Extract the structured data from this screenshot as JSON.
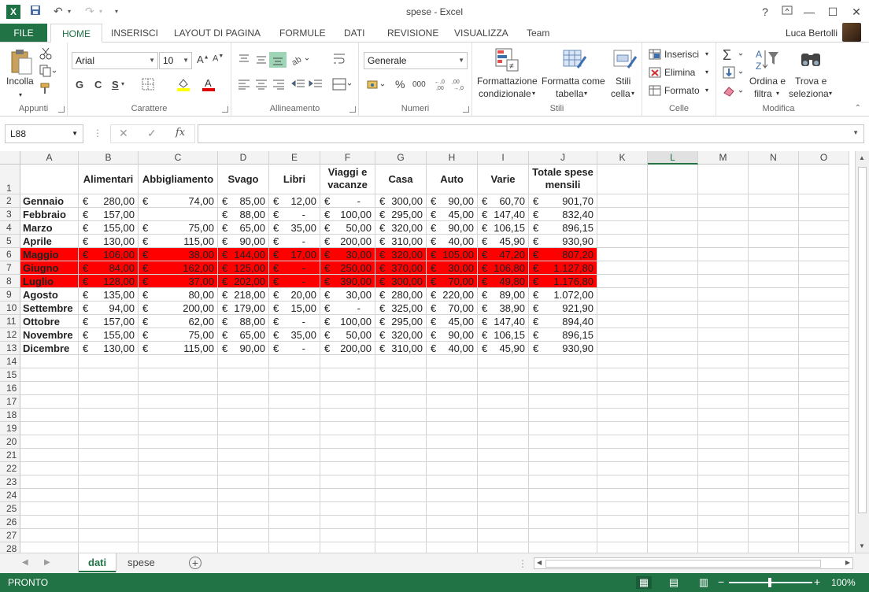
{
  "window": {
    "title": "spese - Excel",
    "help": "?",
    "restore": "□",
    "minimize": "—",
    "maximize": "☐",
    "close": "✕"
  },
  "qat": {
    "save": "💾",
    "undo": "↶",
    "redo": "↷",
    "more": "▾"
  },
  "tabs": {
    "file": "FILE",
    "items": [
      "HOME",
      "INSERISCI",
      "LAYOUT DI PAGINA",
      "FORMULE",
      "DATI",
      "REVISIONE",
      "VISUALIZZA",
      "Team"
    ],
    "user": "Luca Bertolli"
  },
  "ribbon": {
    "clipboard": {
      "paste": "Incolla",
      "label": "Appunti"
    },
    "font": {
      "name": "Arial",
      "size": "10",
      "bold": "G",
      "italic": "C",
      "underline": "S",
      "label": "Carattere"
    },
    "alignment": {
      "label": "Allineamento"
    },
    "number": {
      "format": "Generale",
      "percent": "%",
      "thousands": "000",
      "label": "Numeri"
    },
    "styles": {
      "cond_line1": "Formattazione",
      "cond_line2": "condizionale",
      "table_line1": "Formatta come",
      "table_line2": "tabella",
      "cell_line1": "Stili",
      "cell_line2": "cella",
      "label": "Stili"
    },
    "cells": {
      "insert": "Inserisci",
      "delete": "Elimina",
      "format": "Formato",
      "label": "Celle"
    },
    "editing": {
      "sort_line1": "Ordina e",
      "sort_line2": "filtra",
      "find_line1": "Trova e",
      "find_line2": "seleziona",
      "label": "Modifica"
    }
  },
  "formula_bar": {
    "name_box": "L88",
    "cancel": "✕",
    "enter": "✓",
    "fx": "fx",
    "value": ""
  },
  "columns": [
    "A",
    "B",
    "C",
    "D",
    "E",
    "F",
    "G",
    "H",
    "I",
    "J",
    "K",
    "L",
    "M",
    "N",
    "O"
  ],
  "selected_column": "L",
  "header_row": {
    "num": "1",
    "cells": [
      "",
      "Alimentari",
      "Abbigliamento",
      "Svago",
      "Libri",
      "Viaggi e vacanze",
      "Casa",
      "Auto",
      "Varie",
      "Totale spese mensili"
    ]
  },
  "currency": "€",
  "rows": [
    {
      "num": "2",
      "month": "Gennaio",
      "vals": [
        "280,00",
        "74,00",
        "85,00",
        "12,00",
        "-",
        "300,00",
        "90,00",
        "60,70",
        "901,70"
      ],
      "red": false
    },
    {
      "num": "3",
      "month": "Febbraio",
      "vals": [
        "157,00",
        "",
        "88,00",
        "-",
        "100,00",
        "295,00",
        "45,00",
        "147,40",
        "832,40"
      ],
      "red": false
    },
    {
      "num": "4",
      "month": "Marzo",
      "vals": [
        "155,00",
        "75,00",
        "65,00",
        "35,00",
        "50,00",
        "320,00",
        "90,00",
        "106,15",
        "896,15"
      ],
      "red": false
    },
    {
      "num": "5",
      "month": "Aprile",
      "vals": [
        "130,00",
        "115,00",
        "90,00",
        "-",
        "200,00",
        "310,00",
        "40,00",
        "45,90",
        "930,90"
      ],
      "red": false
    },
    {
      "num": "6",
      "month": "Maggio",
      "vals": [
        "106,00",
        "38,00",
        "144,00",
        "17,00",
        "30,00",
        "320,00",
        "105,00",
        "47,20",
        "807,20"
      ],
      "red": true
    },
    {
      "num": "7",
      "month": "Giugno",
      "vals": [
        "84,00",
        "162,00",
        "125,00",
        "-",
        "250,00",
        "370,00",
        "30,00",
        "106,80",
        "1.127,80"
      ],
      "red": true
    },
    {
      "num": "8",
      "month": "Luglio",
      "vals": [
        "128,00",
        "37,00",
        "202,00",
        "-",
        "390,00",
        "300,00",
        "70,00",
        "49,80",
        "1.176,80"
      ],
      "red": true
    },
    {
      "num": "9",
      "month": "Agosto",
      "vals": [
        "135,00",
        "80,00",
        "218,00",
        "20,00",
        "30,00",
        "280,00",
        "220,00",
        "89,00",
        "1.072,00"
      ],
      "red": false
    },
    {
      "num": "10",
      "month": "Settembre",
      "vals": [
        "94,00",
        "200,00",
        "179,00",
        "15,00",
        "-",
        "325,00",
        "70,00",
        "38,90",
        "921,90"
      ],
      "red": false
    },
    {
      "num": "11",
      "month": "Ottobre",
      "vals": [
        "157,00",
        "62,00",
        "88,00",
        "-",
        "100,00",
        "295,00",
        "45,00",
        "147,40",
        "894,40"
      ],
      "red": false
    },
    {
      "num": "12",
      "month": "Novembre",
      "vals": [
        "155,00",
        "75,00",
        "65,00",
        "35,00",
        "50,00",
        "320,00",
        "90,00",
        "106,15",
        "896,15"
      ],
      "red": false
    },
    {
      "num": "13",
      "month": "Dicembre",
      "vals": [
        "130,00",
        "115,00",
        "90,00",
        "-",
        "200,00",
        "310,00",
        "40,00",
        "45,90",
        "930,90"
      ],
      "red": false
    }
  ],
  "empty_rows": [
    "14",
    "15",
    "16",
    "17",
    "18",
    "19",
    "20",
    "21",
    "22",
    "23",
    "24",
    "25",
    "26",
    "27",
    "28"
  ],
  "sheets": {
    "tabs": [
      "dati",
      "spese"
    ],
    "active": "dati",
    "add": "+"
  },
  "status": {
    "text": "PRONTO",
    "zoom": "100%",
    "minus": "−",
    "plus": "+"
  },
  "colors": {
    "excel_green": "#217346",
    "highlight_red": "#ff0000"
  }
}
